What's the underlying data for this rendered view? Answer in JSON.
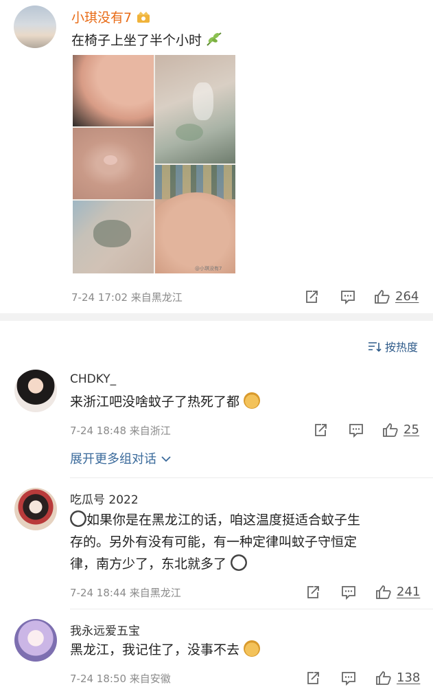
{
  "post": {
    "username": "小琪没有7",
    "text": "在椅子上坐了半个小时",
    "time_location": "7-24 17:02 来自黑龙江",
    "likes": "264",
    "watermark": "@小琪没有7"
  },
  "sort_label": "按热度",
  "comments": [
    {
      "username": "CHDKY_",
      "text": "来浙江吧没啥蚊子了热死了都",
      "time_location": "7-24 18:48 来自浙江",
      "likes": "25",
      "thread_link": "展开更多组对话"
    },
    {
      "username": "吃瓜号 2022",
      "line1": "如果你是在黑龙江的话，咱这温度挺适合蚊子生",
      "line2": "存的。另外有没有可能，有一种定律叫蚊子守恒定",
      "line3": "律，南方少了，东北就多了",
      "time_location": "7-24 18:44 来自黑龙江",
      "likes": "241"
    },
    {
      "username": "我永远爱五宝",
      "text": "黑龙江，我记住了，没事不去",
      "time_location": "7-24 18:50 来自安徽",
      "likes": "138"
    }
  ],
  "colors": {
    "username_orange": "#e86b16",
    "link_blue": "#3a6a9b",
    "meta_gray": "#8a8a8a"
  },
  "icons": [
    "verified-badge-icon",
    "leaf-emoji-icon",
    "share-icon",
    "comment-icon",
    "like-icon",
    "sort-icon",
    "chevron-down-icon",
    "doge-emoji-icon",
    "panda-emoji-icon"
  ]
}
